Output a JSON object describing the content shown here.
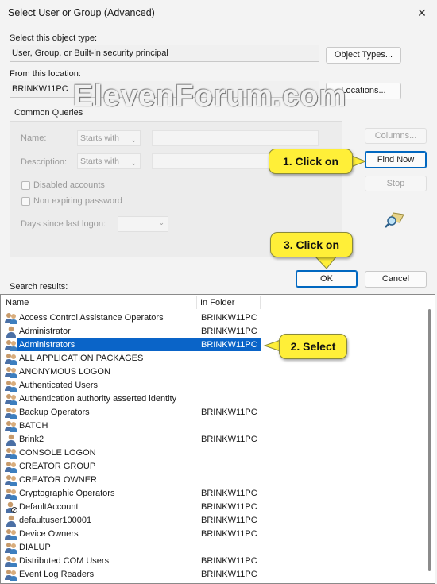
{
  "window": {
    "title": "Select User or Group (Advanced)",
    "close_glyph": "✕"
  },
  "object_type": {
    "label": "Select this object type:",
    "value": "User, Group, or Built-in security principal",
    "button": "Object Types..."
  },
  "location": {
    "label": "From this location:",
    "value": "BRINKW11PC",
    "button": "Locations..."
  },
  "common_queries": {
    "tab": "Common Queries",
    "name_label": "Name:",
    "name_mode": "Starts with",
    "description_label": "Description:",
    "description_mode": "Starts with",
    "disabled_accounts": "Disabled accounts",
    "non_expiring_password": "Non expiring password",
    "days_since_logon_label": "Days since last logon:"
  },
  "side_buttons": {
    "columns": "Columns...",
    "find_now": "Find Now",
    "stop": "Stop"
  },
  "dialog_buttons": {
    "ok": "OK",
    "cancel": "Cancel"
  },
  "results": {
    "label": "Search results:",
    "columns": [
      "Name",
      "In Folder"
    ],
    "selected_index": 2,
    "rows": [
      {
        "name": "Access Control Assistance Operators",
        "folder": "BRINKW11PC",
        "icon": "group-icon"
      },
      {
        "name": "Administrator",
        "folder": "BRINKW11PC",
        "icon": "user-icon"
      },
      {
        "name": "Administrators",
        "folder": "BRINKW11PC",
        "icon": "group-icon"
      },
      {
        "name": "ALL APPLICATION PACKAGES",
        "folder": "",
        "icon": "group-icon"
      },
      {
        "name": "ANONYMOUS LOGON",
        "folder": "",
        "icon": "group-icon"
      },
      {
        "name": "Authenticated Users",
        "folder": "",
        "icon": "group-icon"
      },
      {
        "name": "Authentication authority asserted identity",
        "folder": "",
        "icon": "group-icon"
      },
      {
        "name": "Backup Operators",
        "folder": "BRINKW11PC",
        "icon": "group-icon"
      },
      {
        "name": "BATCH",
        "folder": "",
        "icon": "group-icon"
      },
      {
        "name": "Brink2",
        "folder": "BRINKW11PC",
        "icon": "user-icon"
      },
      {
        "name": "CONSOLE LOGON",
        "folder": "",
        "icon": "group-icon"
      },
      {
        "name": "CREATOR GROUP",
        "folder": "",
        "icon": "group-icon"
      },
      {
        "name": "CREATOR OWNER",
        "folder": "",
        "icon": "group-icon"
      },
      {
        "name": "Cryptographic Operators",
        "folder": "BRINKW11PC",
        "icon": "group-icon"
      },
      {
        "name": "DefaultAccount",
        "folder": "BRINKW11PC",
        "icon": "user-disabled-icon"
      },
      {
        "name": "defaultuser100001",
        "folder": "BRINKW11PC",
        "icon": "user-icon"
      },
      {
        "name": "Device Owners",
        "folder": "BRINKW11PC",
        "icon": "group-icon"
      },
      {
        "name": "DIALUP",
        "folder": "",
        "icon": "group-icon"
      },
      {
        "name": "Distributed COM Users",
        "folder": "BRINKW11PC",
        "icon": "group-icon"
      },
      {
        "name": "Event Log Readers",
        "folder": "BRINKW11PC",
        "icon": "group-icon"
      }
    ]
  },
  "annotations": {
    "callout1": "1. Click on",
    "callout2": "2. Select",
    "callout3": "3. Click on",
    "watermark": "ElevenForum.com"
  },
  "colors": {
    "selection": "#0a64c8",
    "callout": "#ffef38",
    "accent": "#0067c0"
  }
}
